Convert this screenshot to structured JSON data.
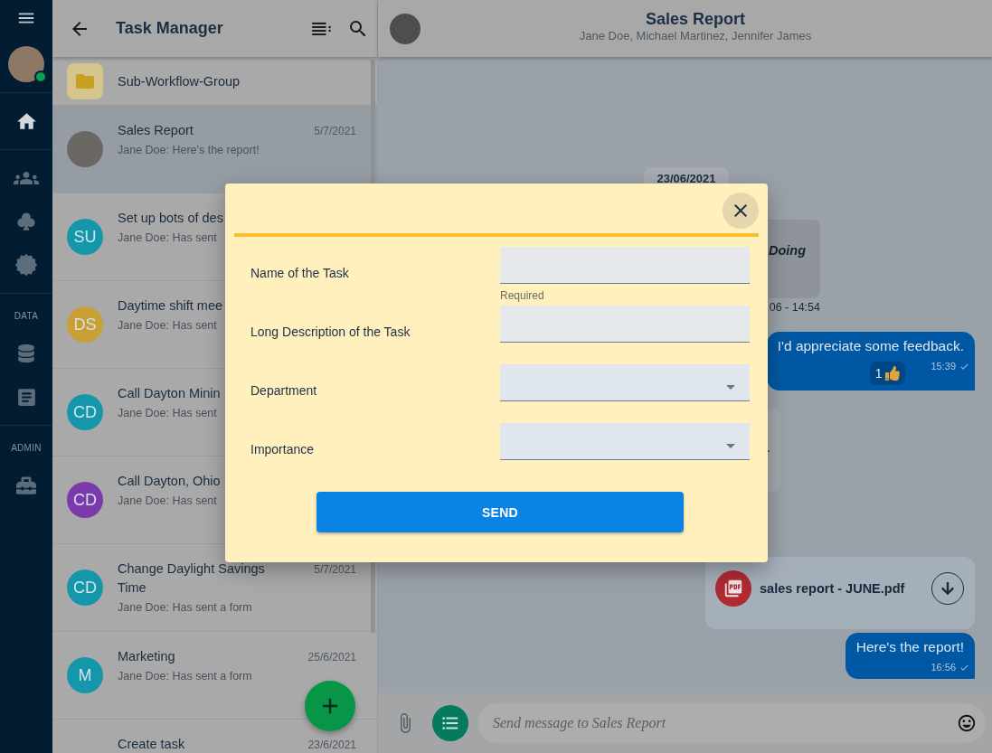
{
  "nav_rail": {
    "user": {
      "online": true
    },
    "groups": [
      {
        "items": [
          {
            "selected": true
          }
        ]
      },
      {
        "items": [
          {
            "selected": false
          },
          {
            "selected": false
          },
          {
            "selected": false
          }
        ]
      },
      {
        "label": "DATA",
        "items": [
          {
            "selected": false
          },
          {
            "selected": false
          }
        ]
      },
      {
        "label": "ADMIN",
        "items": [
          {
            "selected": false
          }
        ]
      }
    ]
  },
  "chat_list": {
    "title": "Task Manager",
    "items": [
      {
        "kind": "folder",
        "title": "Sub-Workflow-Group",
        "selected": false
      },
      {
        "kind": "photo",
        "title": "Sales Report",
        "preview": "Jane Doe: Here's the report!",
        "date": "5/7/2021",
        "selected": true
      },
      {
        "kind": "initials",
        "initials": "SU",
        "color": "#1597ab",
        "title": "Set up bots of des",
        "preview": "Jane Doe: Has sent",
        "selected": false
      },
      {
        "kind": "initials",
        "initials": "DS",
        "color": "#c9a035",
        "title": "Daytime shift mee",
        "preview": "Jane Doe: Has sent",
        "selected": false
      },
      {
        "kind": "initials",
        "initials": "CD",
        "color": "#1597ab",
        "title": "Call Dayton Minin",
        "preview": "Jane Doe: Has sent",
        "selected": false
      },
      {
        "kind": "initials",
        "initials": "CD",
        "color": "#7a3aab",
        "title": "Call Dayton, Ohio",
        "preview": "Jane Doe: Has sent",
        "selected": false
      },
      {
        "kind": "initials",
        "initials": "CD",
        "color": "#1597ab",
        "title": "Change Daylight Savings Time",
        "preview": "Jane Doe: Has sent a form",
        "date": "5/7/2021",
        "selected": false
      },
      {
        "kind": "initials",
        "initials": "M",
        "color": "#1597ab",
        "title": "Marketing",
        "preview": "Jane Doe: Has sent a form",
        "date": "25/6/2021",
        "selected": false
      },
      {
        "kind": "initials",
        "title": "Create task",
        "date": "23/6/2021",
        "selected": false
      }
    ]
  },
  "chat": {
    "title": "Sales Report",
    "participants": "Jane Doe, Michael Martinez, Jennifer James",
    "messages": [
      {
        "kind": "date",
        "text": "23/06/2021"
      },
      {
        "kind": "card",
        "text": "Doing",
        "meta": "06 - 14:54"
      },
      {
        "kind": "outgoing",
        "text": "I'd appreciate some feedback.",
        "reaction": {
          "count": "1"
        },
        "time": "15:39",
        "delivered": true
      },
      {
        "kind": "incoming",
        "text": "."
      },
      {
        "kind": "file",
        "filename": "sales report - JUNE.pdf"
      },
      {
        "kind": "outgoing",
        "text": "Here's the report!",
        "time": "16:56",
        "delivered": true
      }
    ],
    "composer": {
      "placeholder": "Send message to Sales Report"
    }
  },
  "dialog": {
    "fields": [
      {
        "kind": "text",
        "label": "Name of the Task",
        "helper": "Required"
      },
      {
        "kind": "text",
        "label": "Long Description of the Task"
      },
      {
        "kind": "select",
        "label": "Department"
      },
      {
        "kind": "select",
        "label": "Importance"
      }
    ],
    "submit": "SEND"
  }
}
